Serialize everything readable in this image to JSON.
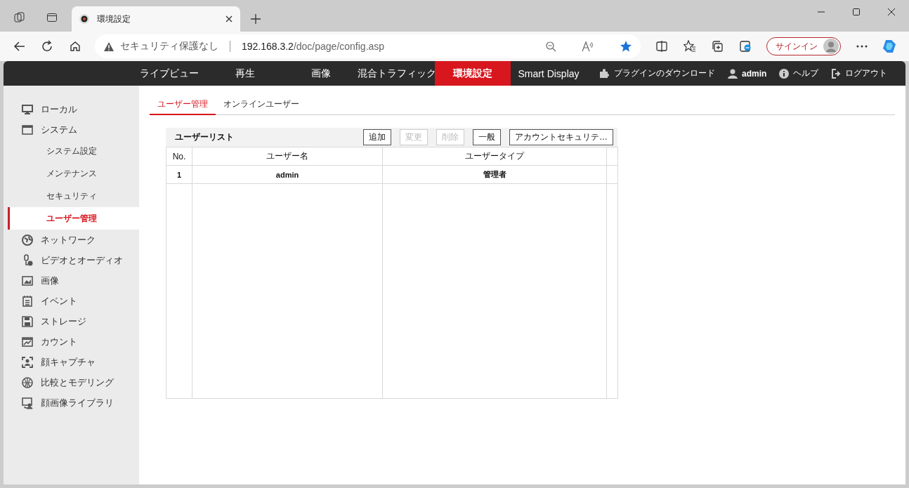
{
  "browser": {
    "tabs": [
      {
        "title": "環境設定",
        "selected": true
      }
    ],
    "address": {
      "security": "セキュリティ保護なし",
      "host": "192.168.3.2",
      "path": "/doc/page/config.asp"
    },
    "signin": "サインイン"
  },
  "nav": {
    "items": [
      {
        "label": "ライブビュー",
        "selected": false
      },
      {
        "label": "再生",
        "selected": false
      },
      {
        "label": "画像",
        "selected": false
      },
      {
        "label": "混合トラフィック",
        "selected": false
      },
      {
        "label": "環境設定",
        "selected": true
      },
      {
        "label": "Smart Display",
        "selected": false
      }
    ],
    "plugin": "プラグインのダウンロード",
    "user": "admin",
    "help": "ヘルプ",
    "logout": "ログアウト"
  },
  "sidebar": {
    "items": [
      {
        "label": "ローカル",
        "selected": false
      },
      {
        "label": "システム",
        "selected": false,
        "children": [
          {
            "label": "システム設定",
            "selected": false
          },
          {
            "label": "メンテナンス",
            "selected": false
          },
          {
            "label": "セキュリティ",
            "selected": false
          },
          {
            "label": "ユーザー管理",
            "selected": true
          }
        ]
      },
      {
        "label": "ネットワーク",
        "selected": false
      },
      {
        "label": "ビデオとオーディオ",
        "selected": false
      },
      {
        "label": "画像",
        "selected": false
      },
      {
        "label": "イベント",
        "selected": false
      },
      {
        "label": "ストレージ",
        "selected": false
      },
      {
        "label": "カウント",
        "selected": false
      },
      {
        "label": "顔キャプチャ",
        "selected": false
      },
      {
        "label": "比較とモデリング",
        "selected": false
      },
      {
        "label": "顔画像ライブラリ",
        "selected": false
      }
    ]
  },
  "tabs": [
    {
      "label": "ユーザー管理",
      "selected": true
    },
    {
      "label": "オンラインユーザー",
      "selected": false
    }
  ],
  "user_list": {
    "title": "ユーザーリスト",
    "buttons": [
      {
        "label": "追加",
        "disabled": false
      },
      {
        "label": "変更",
        "disabled": true
      },
      {
        "label": "削除",
        "disabled": true
      },
      {
        "label": "一般",
        "disabled": false
      },
      {
        "label": "アカウントセキュリテ…",
        "disabled": false
      }
    ],
    "table": {
      "columns": [
        "No.",
        "ユーザー名",
        "ユーザータイプ"
      ],
      "rows": [
        [
          "1",
          "admin",
          "管理者"
        ]
      ]
    }
  }
}
